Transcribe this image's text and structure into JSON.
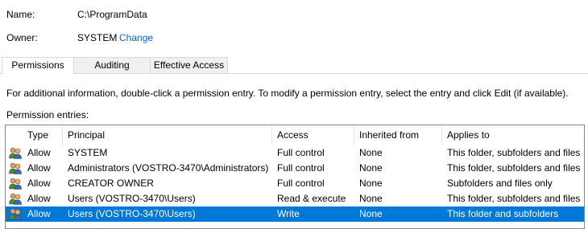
{
  "header": {
    "name_label": "Name:",
    "name_value": "C:\\ProgramData",
    "owner_label": "Owner:",
    "owner_value": "SYSTEM",
    "change_link": "Change"
  },
  "tabs": [
    {
      "label": "Permissions",
      "active": true
    },
    {
      "label": "Auditing",
      "active": false
    },
    {
      "label": "Effective Access",
      "active": false
    }
  ],
  "info_text": "For additional information, double-click a permission entry. To modify a permission entry, select the entry and click Edit (if available).",
  "entries_label": "Permission entries:",
  "columns": [
    "Type",
    "Principal",
    "Access",
    "Inherited from",
    "Applies to"
  ],
  "rows": [
    {
      "type": "Allow",
      "principal": "SYSTEM",
      "access": "Full control",
      "inherited": "None",
      "applies": "This folder, subfolders and files",
      "selected": false
    },
    {
      "type": "Allow",
      "principal": "Administrators (VOSTRO-3470\\Administrators)",
      "access": "Full control",
      "inherited": "None",
      "applies": "This folder, subfolders and files",
      "selected": false
    },
    {
      "type": "Allow",
      "principal": "CREATOR OWNER",
      "access": "Full control",
      "inherited": "None",
      "applies": "Subfolders and files only",
      "selected": false
    },
    {
      "type": "Allow",
      "principal": "Users (VOSTRO-3470\\Users)",
      "access": "Read & execute",
      "inherited": "None",
      "applies": "This folder, subfolders and files",
      "selected": false
    },
    {
      "type": "Allow",
      "principal": "Users (VOSTRO-3470\\Users)",
      "access": "Write",
      "inherited": "None",
      "applies": "This folder and subfolders",
      "selected": true
    }
  ],
  "colors": {
    "selection": "#0078d7",
    "link": "#0066cc"
  }
}
